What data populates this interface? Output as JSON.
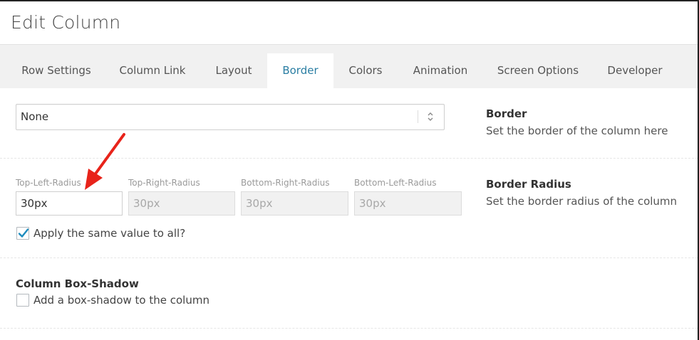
{
  "header": {
    "title": "Edit Column"
  },
  "tabs": [
    {
      "label": "Row Settings"
    },
    {
      "label": "Column Link"
    },
    {
      "label": "Layout"
    },
    {
      "label": "Border",
      "active": true
    },
    {
      "label": "Colors"
    },
    {
      "label": "Animation"
    },
    {
      "label": "Screen Options"
    },
    {
      "label": "Developer"
    }
  ],
  "border": {
    "select_value": "None",
    "title": "Border",
    "description": "Set the border of the column here"
  },
  "radius": {
    "title": "Border Radius",
    "description": "Set the border radius of the column",
    "fields": [
      {
        "label": "Top-Left-Radius",
        "value": "30px",
        "enabled": true
      },
      {
        "label": "Top-Right-Radius",
        "value": "30px",
        "enabled": false
      },
      {
        "label": "Bottom-Right-Radius",
        "value": "30px",
        "enabled": false
      },
      {
        "label": "Bottom-Left-Radius",
        "value": "30px",
        "enabled": false
      }
    ],
    "same_value_label": "Apply the same value to all?",
    "same_value_checked": true
  },
  "shadow": {
    "title": "Column Box-Shadow",
    "checkbox_label": "Add a box-shadow to the column",
    "checked": false
  },
  "colors": {
    "accent": "#2a7ea3",
    "check": "#1e8cbe",
    "annotation_arrow": "#e8231a"
  }
}
